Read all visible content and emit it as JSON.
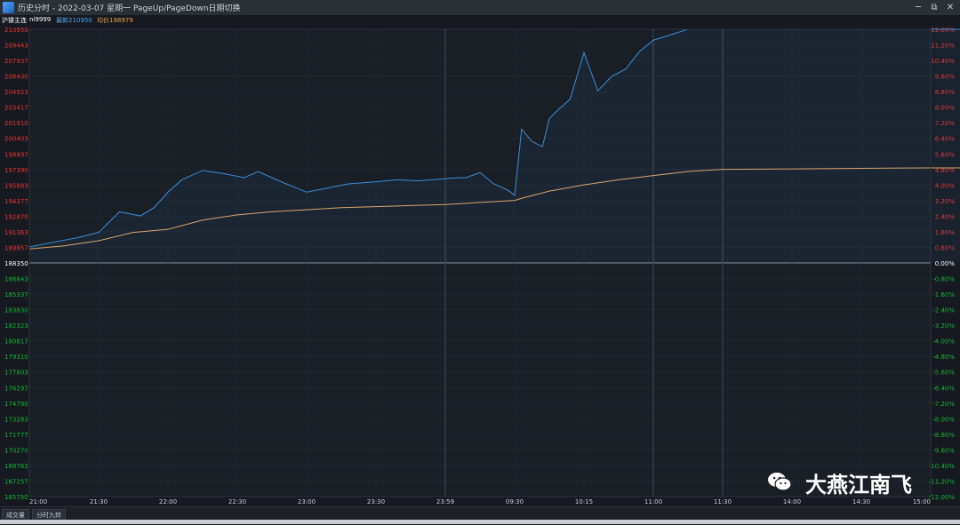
{
  "window": {
    "title": "历史分时 - 2022-03-07 星期一 PageUp/PageDown日期切换",
    "buttons": [
      "─",
      "⧉",
      "✕"
    ]
  },
  "infobar": {
    "instrument": "沪镍主连",
    "code": "ni9999",
    "latest_label": "最新210950",
    "avg_label": "均价198979"
  },
  "tabs": [
    "成交量",
    "分时九转"
  ],
  "watermark": {
    "text": "大燕江南飞",
    "icon": "wechat-icon"
  },
  "colors": {
    "price_line": "#3c8fd8",
    "avg_line": "#d8a56a",
    "up": "#e53935",
    "down": "#15b83c",
    "flat": "#ffffff"
  },
  "chart_data": {
    "type": "line",
    "x_labels": [
      "21:00",
      "21:30",
      "22:00",
      "22:30",
      "23:00",
      "23:30",
      "23:59",
      "09:30",
      "10:15",
      "11:00",
      "11:30",
      "14:00",
      "14:30",
      "15:00"
    ],
    "left_axis_labels": [
      "210950",
      "209443",
      "207937",
      "206430",
      "204923",
      "203417",
      "201910",
      "200403",
      "198897",
      "197390",
      "195883",
      "194377",
      "192870",
      "191363",
      "189857",
      "188350",
      "186843",
      "185337",
      "183830",
      "182323",
      "180817",
      "179310",
      "177803",
      "176297",
      "174790",
      "173283",
      "171777",
      "170270",
      "168763",
      "167257",
      "165750"
    ],
    "right_axis_labels": [
      "12.00%",
      "11.20%",
      "10.40%",
      "9.60%",
      "8.80%",
      "8.00%",
      "7.20%",
      "6.40%",
      "5.60%",
      "4.80%",
      "4.00%",
      "3.20%",
      "2.40%",
      "1.60%",
      "0.80%",
      "0.00%",
      "-0.80%",
      "-1.60%",
      "-2.40%",
      "-3.20%",
      "-4.00%",
      "-4.80%",
      "-5.60%",
      "-6.40%",
      "-7.20%",
      "-8.00%",
      "-8.80%",
      "-9.60%",
      "-10.40%",
      "-11.20%",
      "-12.00%"
    ],
    "ylim": [
      165750,
      210950
    ],
    "base_price": 188350,
    "grid": true,
    "series": [
      {
        "name": "最新",
        "x": [
          0,
          0.3,
          0.7,
          1.0,
          1.3,
          1.6,
          1.8,
          2.0,
          2.2,
          2.5,
          2.8,
          3.1,
          3.3,
          3.6,
          4.0,
          4.3,
          4.6,
          5.0,
          5.3,
          5.6,
          5.8,
          6.0,
          6.2,
          6.3,
          6.5,
          6.7,
          6.9,
          7.0,
          7.1,
          7.25,
          7.4,
          7.5,
          7.6,
          7.8,
          8.0,
          8.2,
          8.4,
          8.6,
          8.8,
          9.0,
          9.5,
          10,
          10.5,
          11,
          11.5,
          12,
          12.5,
          13,
          13.5
        ],
        "y": [
          189900,
          190300,
          190800,
          191300,
          193300,
          192900,
          193700,
          195200,
          196400,
          197300,
          197000,
          196600,
          197200,
          196300,
          195200,
          195600,
          196000,
          196200,
          196400,
          196300,
          196400,
          196500,
          196600,
          196600,
          197100,
          196000,
          195400,
          194900,
          201300,
          200100,
          199600,
          202300,
          203000,
          204200,
          208700,
          205000,
          206400,
          207100,
          208800,
          209900,
          210950,
          210950,
          210950,
          210950,
          210950,
          210950,
          210950,
          210950,
          210950
        ]
      },
      {
        "name": "均价",
        "x": [
          0,
          0.5,
          1.0,
          1.5,
          2.0,
          2.5,
          3.0,
          3.5,
          4.0,
          4.5,
          5.0,
          5.5,
          6.0,
          6.5,
          7.0,
          7.1,
          7.5,
          8.0,
          8.5,
          9.0,
          9.5,
          10,
          11,
          12,
          13,
          13.5
        ],
        "y": [
          189700,
          190000,
          190500,
          191300,
          191600,
          192500,
          193000,
          193300,
          193500,
          193700,
          193800,
          193900,
          194000,
          194200,
          194400,
          194600,
          195300,
          195900,
          196400,
          196800,
          197200,
          197400,
          197450,
          197500,
          197550,
          197550
        ]
      }
    ]
  }
}
